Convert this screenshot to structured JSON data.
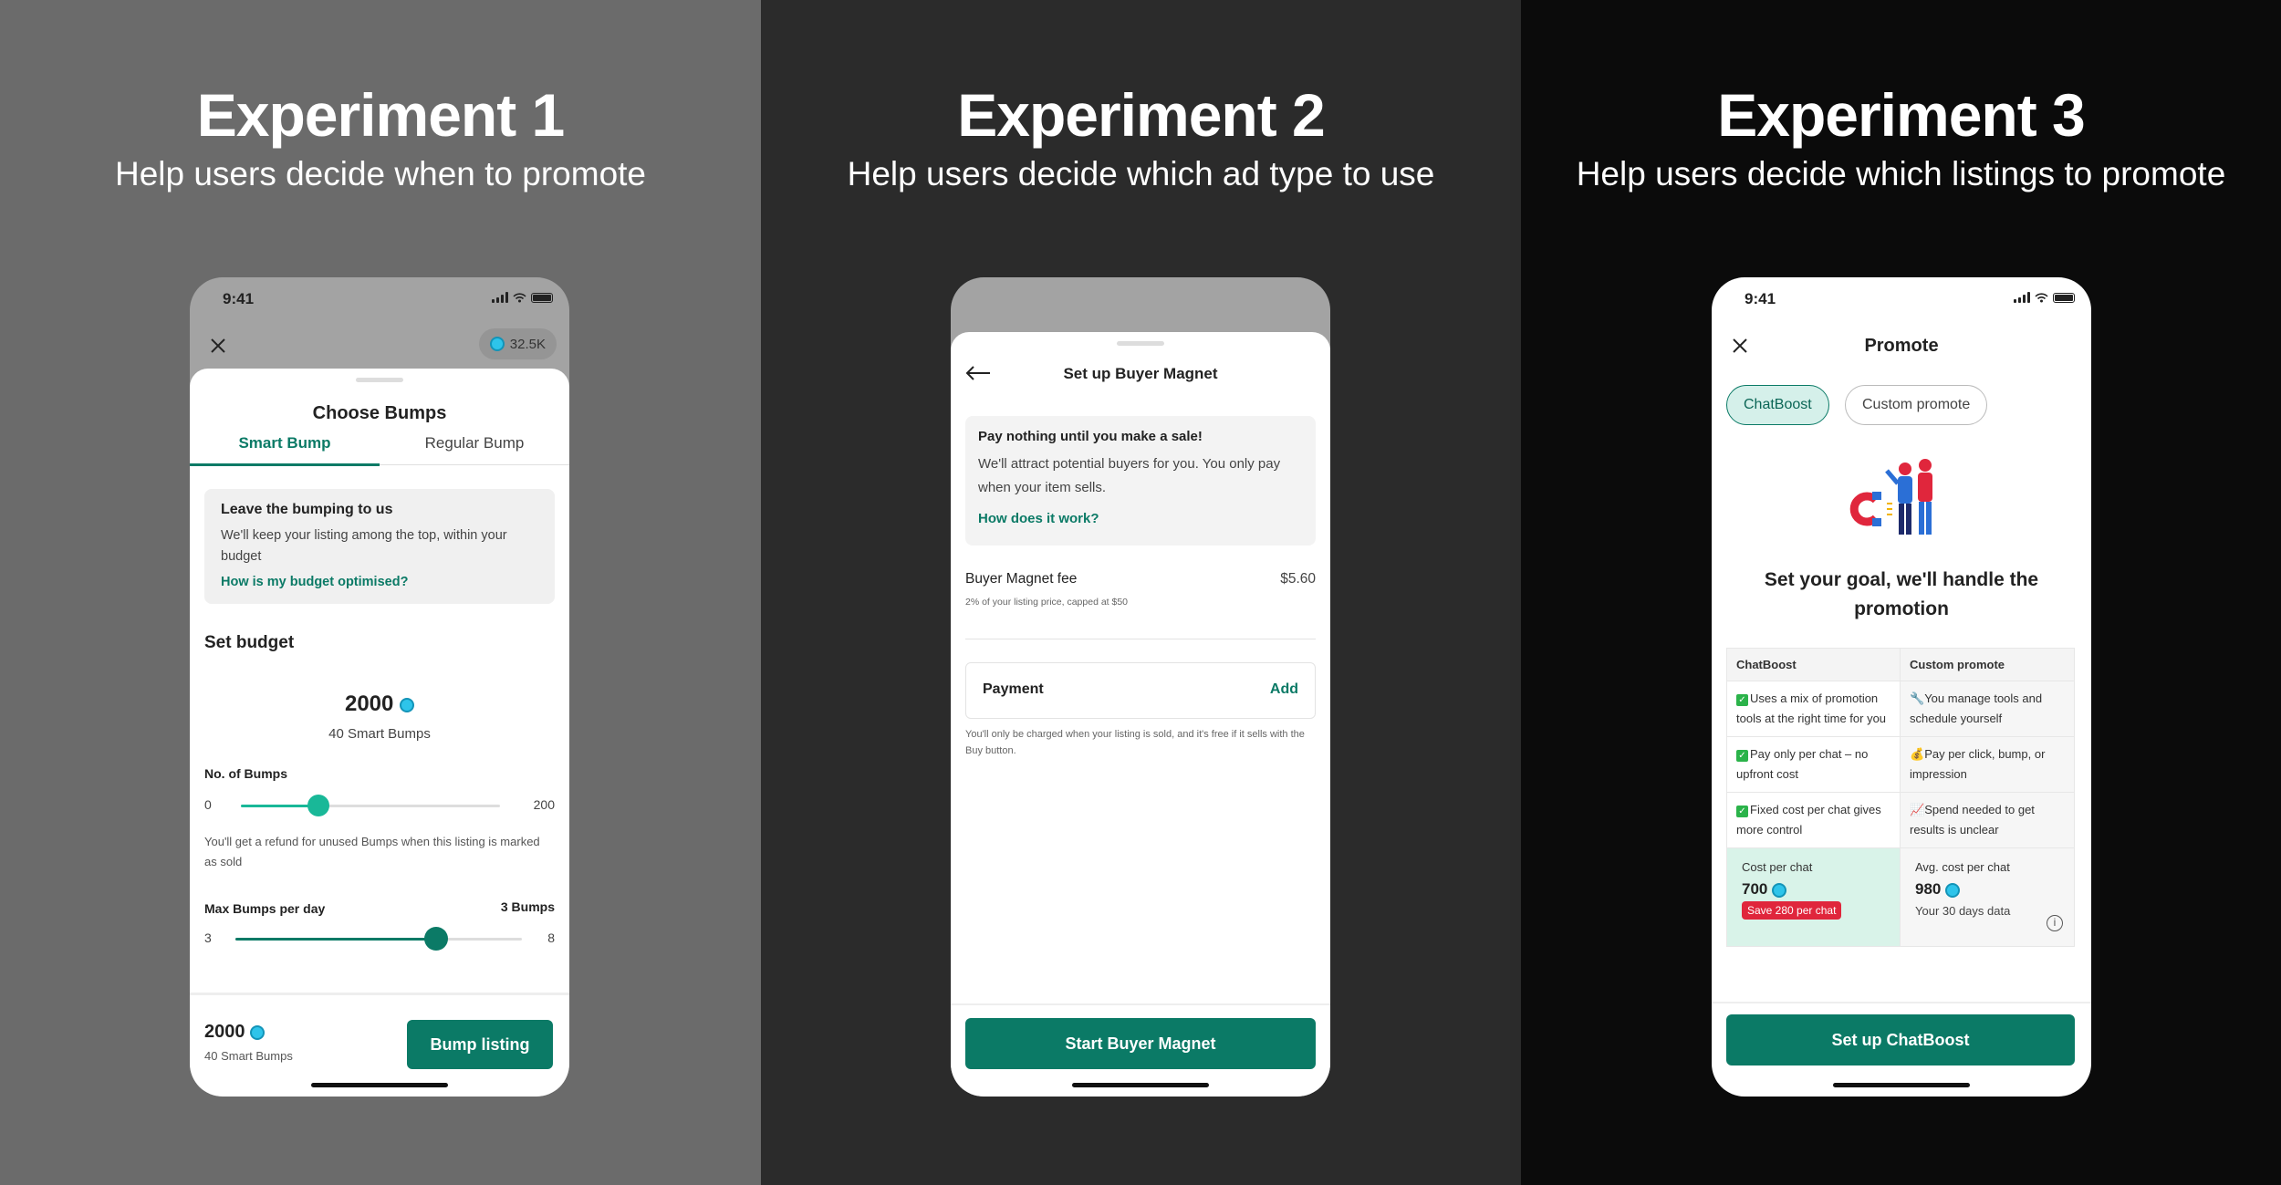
{
  "panels": [
    {
      "title": "Experiment 1",
      "subtitle": "Help users decide when to promote"
    },
    {
      "title": "Experiment 2",
      "subtitle": "Help users decide which ad type to use"
    },
    {
      "title": "Experiment 3",
      "subtitle": "Help users decide which listings to promote"
    }
  ],
  "exp1": {
    "time": "9:41",
    "balance": "32.5K",
    "sheet_title": "Choose Bumps",
    "tabs": [
      "Smart Bump",
      "Regular Bump"
    ],
    "info_title": "Leave the bumping to us",
    "info_body": "We'll keep your listing among the top, within your budget",
    "info_link": "How is my budget optimised?",
    "set_budget": "Set budget",
    "budget_value": "2000",
    "budget_caption": "40 Smart Bumps",
    "bumps_label": "No. of Bumps",
    "bumps_min": "0",
    "bumps_max": "200",
    "bumps_fraction": 0.3,
    "refund_note": "You'll get a refund for unused Bumps when this listing is marked as sold",
    "perday_label": "Max Bumps per day",
    "perday_value": "3 Bumps",
    "perday_min": "3",
    "perday_max": "8",
    "perday_fraction": 0.7,
    "footer_value": "2000",
    "footer_caption": "40 Smart Bumps",
    "cta": "Bump listing"
  },
  "exp2": {
    "header": "Set up Buyer Magnet",
    "info_title": "Pay nothing until you make a sale!",
    "info_body": "We'll attract potential buyers for you. You only pay when your item sells.",
    "info_link": "How does it work?",
    "fee_label": "Buyer Magnet fee",
    "fee_value": "$5.60",
    "fee_note": "2% of your listing price, capped at $50",
    "payment_label": "Payment",
    "payment_action": "Add",
    "charge_note": "You'll only be charged when your listing is sold, and it's free if it sells with the Buy button.",
    "cta": "Start Buyer Magnet"
  },
  "exp3": {
    "time": "9:41",
    "header": "Promote",
    "chips": [
      "ChatBoost",
      "Custom promote"
    ],
    "headline": "Set your goal, we'll handle the promotion",
    "table": {
      "col_a": "ChatBoost",
      "col_b": "Custom promote",
      "rows": [
        {
          "a": "Uses a mix of promotion tools at the right time for you",
          "b": "You manage tools and schedule yourself"
        },
        {
          "a": "Pay only per chat – no upfront cost",
          "b": "Pay per click, bump, or impression"
        },
        {
          "a": "Fixed cost per chat gives more control",
          "b": "Spend needed to get results is unclear"
        }
      ],
      "cost_a_label": "Cost per chat",
      "cost_a_value": "700",
      "save_badge": "Save 280 per chat",
      "cost_b_label": "Avg. cost per chat",
      "cost_b_value": "980",
      "cost_b_note": "Your 30 days data"
    },
    "cta": "Set up ChatBoost"
  },
  "colors": {
    "accent": "#0b7a66",
    "chip_bg": "#d5f0ea",
    "save_red": "#e0263c",
    "coin": "#2ec4ea"
  }
}
